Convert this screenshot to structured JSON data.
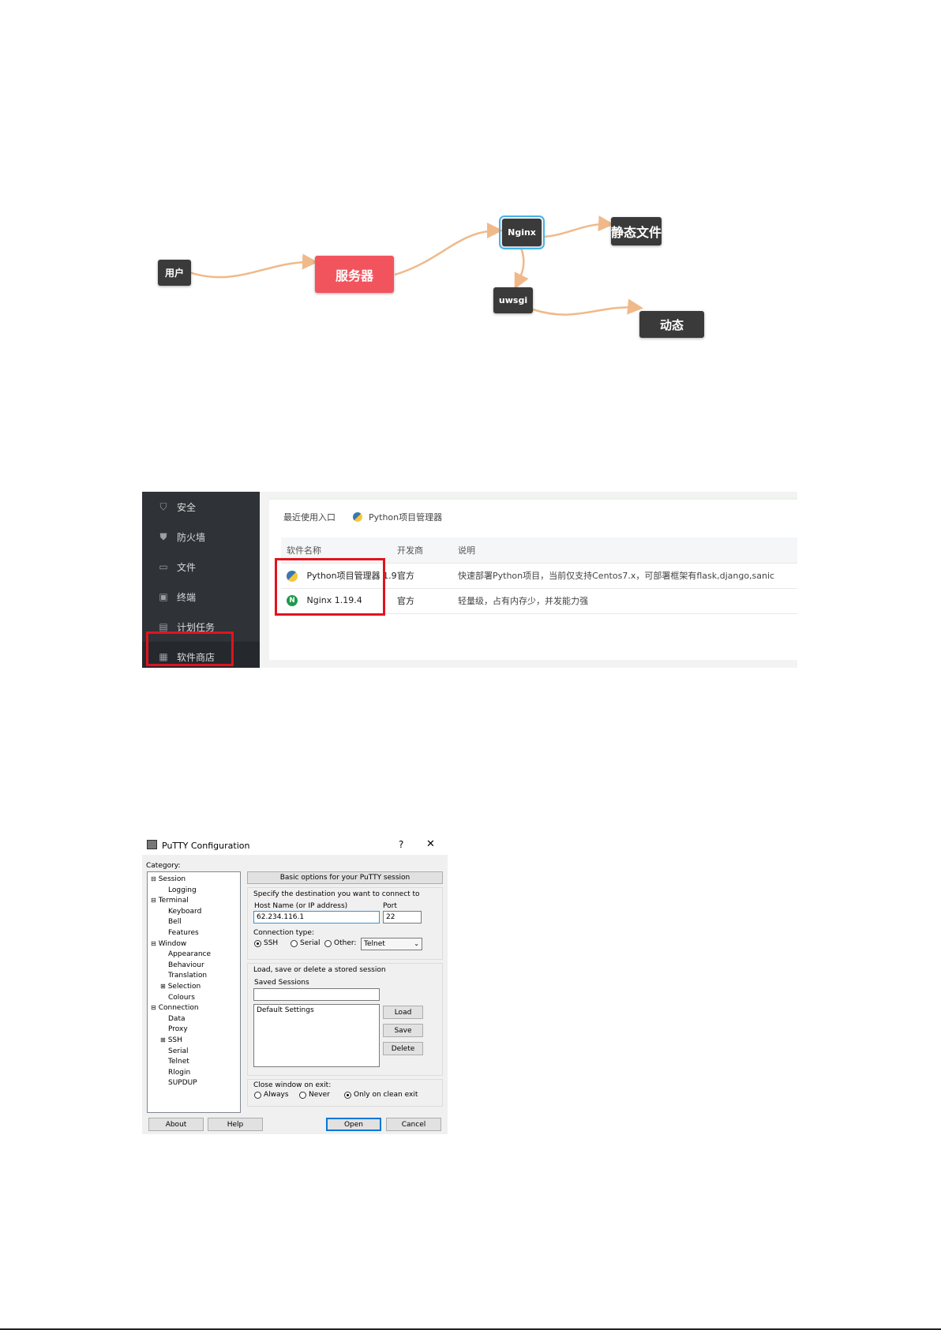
{
  "diagram": {
    "nodes": {
      "user": "用户",
      "server": "服务器",
      "nginx": "Nginx",
      "static": "静态文件",
      "uwsgi": "uwsgi",
      "dynamic": "动态"
    }
  },
  "bt_panel": {
    "sidebar": [
      {
        "icon": "shield-outline-icon",
        "label": "安全"
      },
      {
        "icon": "shield-filled-icon",
        "label": "防火墙"
      },
      {
        "icon": "folder-icon",
        "label": "文件"
      },
      {
        "icon": "terminal-icon",
        "label": "终端"
      },
      {
        "icon": "calendar-icon",
        "label": "计划任务"
      },
      {
        "icon": "apps-grid-icon",
        "label": "软件商店"
      }
    ],
    "active_item": "软件商店",
    "recent_label": "最近使用入口",
    "recent_item": "Python项目管理器",
    "table": {
      "headers": [
        "软件名称",
        "开发商",
        "说明"
      ],
      "rows": [
        {
          "icon": "python-icon",
          "name": "Python项目管理器 1.9",
          "vendor": "官方",
          "desc": "快速部署Python项目，当前仅支持Centos7.x，可部署框架有flask,django,sanic"
        },
        {
          "icon": "nginx-icon",
          "name": "Nginx 1.19.4",
          "vendor": "官方",
          "desc": "轻量级，占有内存少，并发能力强"
        }
      ]
    },
    "highlight_color": "#e0141e"
  },
  "putty": {
    "title": "PuTTY Configuration",
    "help_glyph": "?",
    "close_glyph": "✕",
    "category_label": "Category:",
    "tree": [
      {
        "label": "Session",
        "level": 0,
        "expander": "⊟"
      },
      {
        "label": "Logging",
        "level": 1
      },
      {
        "label": "Terminal",
        "level": 0,
        "expander": "⊟"
      },
      {
        "label": "Keyboard",
        "level": 1
      },
      {
        "label": "Bell",
        "level": 1
      },
      {
        "label": "Features",
        "level": 1
      },
      {
        "label": "Window",
        "level": 0,
        "expander": "⊟"
      },
      {
        "label": "Appearance",
        "level": 1
      },
      {
        "label": "Behaviour",
        "level": 1
      },
      {
        "label": "Translation",
        "level": 1
      },
      {
        "label": "Selection",
        "level": 1,
        "expander": "⊞"
      },
      {
        "label": "Colours",
        "level": 1
      },
      {
        "label": "Connection",
        "level": 0,
        "expander": "⊟"
      },
      {
        "label": "Data",
        "level": 1
      },
      {
        "label": "Proxy",
        "level": 1
      },
      {
        "label": "SSH",
        "level": 1,
        "expander": "⊞"
      },
      {
        "label": "Serial",
        "level": 1
      },
      {
        "label": "Telnet",
        "level": 1
      },
      {
        "label": "Rlogin",
        "level": 1
      },
      {
        "label": "SUPDUP",
        "level": 1
      }
    ],
    "panel_title": "Basic options for your PuTTY session",
    "dest_label": "Specify the destination you want to connect to",
    "host_label": "Host Name (or IP address)",
    "host_value": "62.234.116.1",
    "port_label": "Port",
    "port_value": "22",
    "conn_type_label": "Connection type:",
    "conn_types": [
      "SSH",
      "Serial",
      "Other:"
    ],
    "conn_selected": "SSH",
    "other_select_value": "Telnet",
    "sessions_group_label": "Load, save or delete a stored session",
    "saved_sessions_label": "Saved Sessions",
    "saved_sessions_value": "",
    "session_list": [
      "Default Settings"
    ],
    "load_label": "Load",
    "save_label": "Save",
    "delete_label": "Delete",
    "close_label": "Close window on exit:",
    "close_options": [
      "Always",
      "Never",
      "Only on clean exit"
    ],
    "close_selected": "Only on clean exit",
    "about_label": "About",
    "help_label": "Help",
    "open_label": "Open",
    "cancel_label": "Cancel"
  }
}
